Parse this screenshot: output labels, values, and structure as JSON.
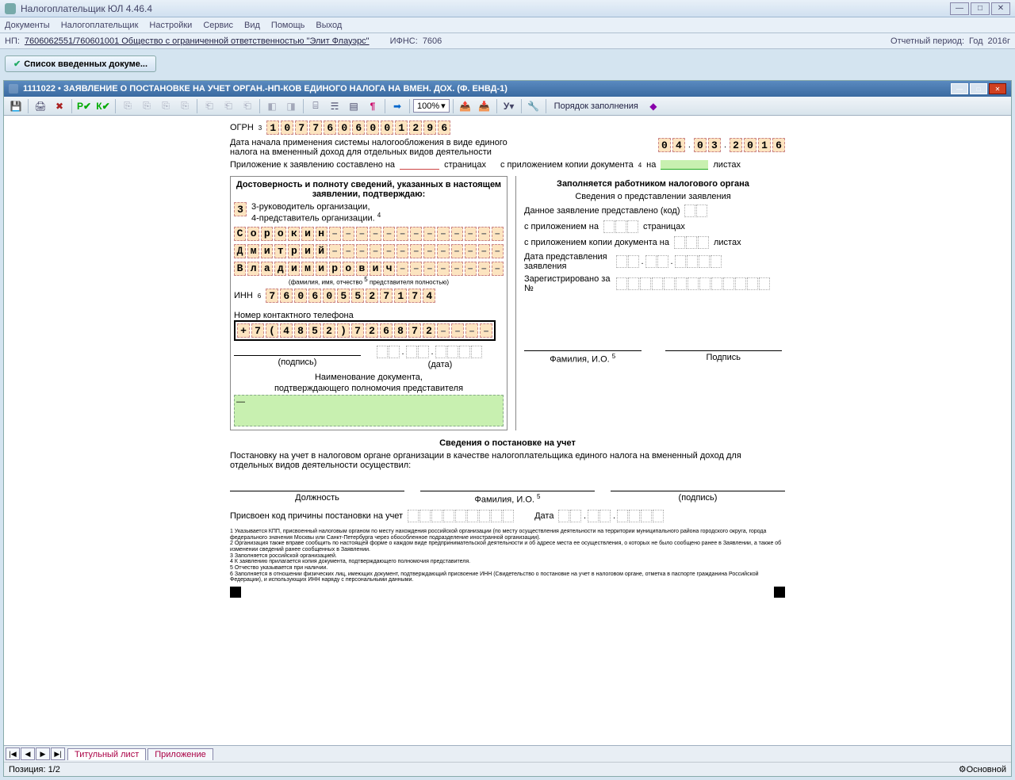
{
  "app": {
    "title": "Налогоплательщик ЮЛ 4.46.4",
    "menu": [
      "Документы",
      "Налогоплательщик",
      "Настройки",
      "Сервис",
      "Вид",
      "Помощь",
      "Выход"
    ],
    "np_label": "НП:",
    "np_value": "7606062551/760601001 Общество с ограниченной ответственностью \"Элит Флауэрс\"",
    "ifns_label": "ИФНС:",
    "ifns_value": "7606",
    "period_label": "Отчетный период:",
    "period_type": "Год",
    "period_value": "2016г",
    "list_button": "Список введенных докуме..."
  },
  "doc": {
    "title": "1111022 • ЗАЯВЛЕНИЕ О ПОСТАНОВКЕ НА УЧЕТ ОРГАН.-НП-КОВ ЕДИНОГО НАЛОГА НА ВМЕН. ДОХ. (Ф. ЕНВД-1)",
    "zoom": "100%",
    "order_label": "Порядок заполнения",
    "tabs": [
      "Титульный лист",
      "Приложение"
    ],
    "position": "Позиция: 1/2",
    "mode": "Основной"
  },
  "form": {
    "ogrn_label": "ОГРН",
    "ogrn_sup": "3",
    "ogrn": "1077606001296",
    "date_start_label": "Дата начала применения системы налогообложения в виде единого налога на вмененный доход для отдельных видов деятельности",
    "date_start": {
      "d": "04",
      "m": "03",
      "y": "2016"
    },
    "app_pages_label1": "Приложение к заявлению составлено на",
    "app_pages_label2": "страницах",
    "app_copy_label1": "с приложением копии документа",
    "app_copy_sup": "4",
    "app_copy_label2": "на",
    "app_copy_label3": "листах",
    "confirm_title": "Достоверность и полноту сведений, указанных в настоящем заявлении, подтверждаю:",
    "opt3": "3-руководитель организации,",
    "opt4": "4-представитель организации.",
    "opt4_sup": "4",
    "person_type": "3",
    "surname": "Сорокин",
    "name": "Дмитрий",
    "patronymic": "Владимирович",
    "fio_note": "(фамилия, имя, отчество",
    "fio_sup": "5",
    "fio_note2": "представителя полностью)",
    "inn_label": "ИНН",
    "inn_sup": "6",
    "inn": "760605527174",
    "phone_label": "Номер контактного телефона",
    "phone": "+7(4852)726872----",
    "sign_label": "(подпись)",
    "date_label": "(дата)",
    "doc_name_label1": "Наименование документа,",
    "doc_name_label2": "подтверждающего полномочия представителя",
    "doc_name_value": "—",
    "official_title": "Заполняется работником налогового органа",
    "official_sub": "Сведения о представлении заявления",
    "code_label": "Данное заявление представлено (код)",
    "with_app_label": "с приложением на",
    "with_app_unit": "страницах",
    "with_copy_label": "с приложением копии документа на",
    "with_copy_unit": "листах",
    "submit_date_label": "Дата представления заявления",
    "reg_label": "Зарегистрировано за №",
    "fio_io": "Фамилия, И.О.",
    "fio_io_sup": "5",
    "sig_label": "Подпись",
    "reg_title": "Сведения о постановке на учет",
    "reg_text": "Постановку на учет в налоговом органе организации в качестве налогоплательщика единого налога на вмененный доход для отдельных видов деятельности осуществил:",
    "post_label": "Должность",
    "kpp_label": "Присвоен код причины постановки на учет",
    "reg_date_label": "Дата",
    "footnotes": [
      "1 Указывается КПП, присвоенный налоговым органом по месту нахождения российской организации (по месту осуществления деятельности на территории муниципального района городского округа, города федерального значения Москвы или Санкт-Петербурга через обособленное подразделение иностранной организации).",
      "2 Организация также вправе сообщить по настоящей форме о каждом виде предпринимательской деятельности и об адресе места ее осуществления, о которых не было сообщено ранее в Заявлении, а также об изменении сведений ранее сообщенных в Заявлении.",
      "3 Заполняется российской организацией.",
      "4 К заявлению прилагается копия документа, подтверждающего полномочия представителя.",
      "5 Отчество указывается при наличии.",
      "6 Заполняется в отношении физических лиц, имеющих документ, подтверждающий присвоение ИНН (Свидетельство о постановке на учет в налоговом органе, отметка в паспорте гражданина Российской Федерации), и использующих ИНН наряду с персональными данными."
    ]
  }
}
